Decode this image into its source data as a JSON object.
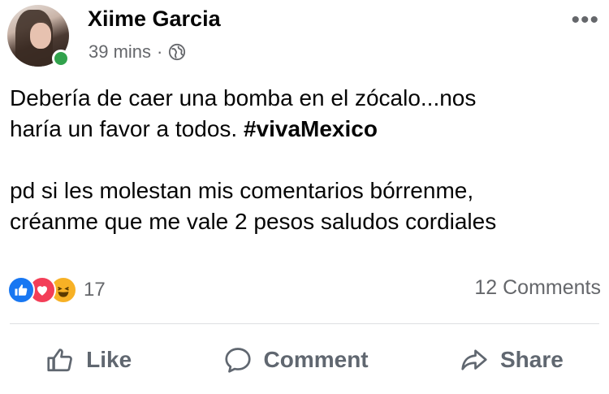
{
  "post": {
    "author": "Xiime Garcia",
    "time": "39 mins",
    "separator": "·",
    "privacy_icon": "globe-icon",
    "more_icon": "more-options-icon",
    "text_line1": "Debería de caer una bomba en el zócalo...nos",
    "text_line2_prefix": "haría un favor a todos. ",
    "hashtag": "#vivaMexico",
    "text_line3": "pd si les molestan mis comentarios bórrenme,",
    "text_line4": "créanme que me vale 2 pesos  saludos cordiales",
    "online": true
  },
  "stats": {
    "reaction_icons": [
      "like-reaction-icon",
      "love-reaction-icon",
      "haha-reaction-icon"
    ],
    "reaction_count": "17",
    "comments": "12 Comments"
  },
  "actions": {
    "like": "Like",
    "comment": "Comment",
    "share": "Share"
  },
  "colors": {
    "like_blue": "#1877f2",
    "love_red": "#f33e58",
    "haha_yellow": "#f7b125",
    "online_green": "#31a24c",
    "secondary_text": "#65676b"
  }
}
